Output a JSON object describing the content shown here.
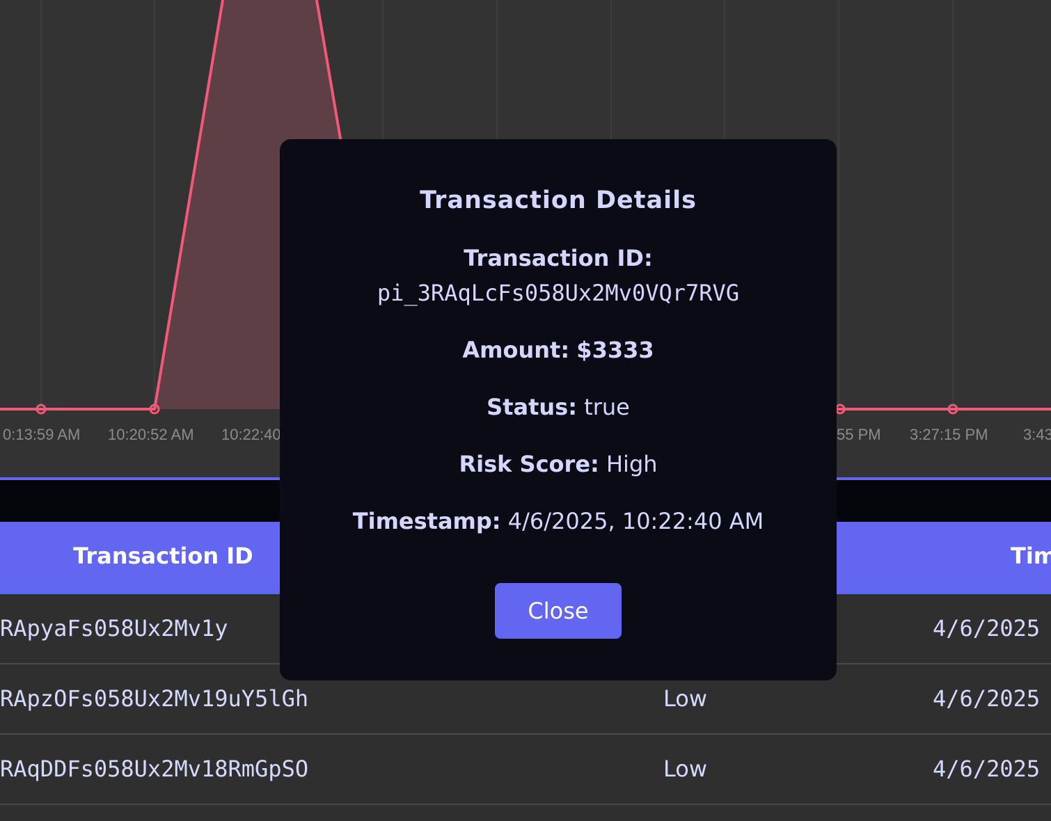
{
  "chart": {
    "x_ticks": [
      "0:13:59 AM",
      "10:20:52 AM",
      "10:22:40",
      "55 PM",
      "3:27:15 PM",
      "3:43"
    ],
    "line_color": "#f05a78",
    "fill_color": "#5e3f45"
  },
  "table": {
    "headers": {
      "transaction_id": "Transaction ID",
      "timestamp": "Tim"
    },
    "rows": [
      {
        "id": "RApyaFs058Ux2Mv1y",
        "risk": "",
        "time": "4/6/2025"
      },
      {
        "id": "RApzOFs058Ux2Mv19uY5lGh",
        "risk": "Low",
        "time": "4/6/2025"
      },
      {
        "id": "RAqDDFs058Ux2Mv18RmGpSO",
        "risk": "Low",
        "time": "4/6/2025"
      }
    ]
  },
  "modal": {
    "title": "Transaction Details",
    "transaction_id_label": "Transaction ID:",
    "transaction_id_value": "pi_3RAqLcFs058Ux2Mv0VQr7RVG",
    "amount_label": "Amount:",
    "amount_value": "$3333",
    "status_label": "Status:",
    "status_value": "true",
    "risk_label": "Risk Score:",
    "risk_value": "High",
    "timestamp_label": "Timestamp:",
    "timestamp_value": "4/6/2025, 10:22:40 AM",
    "close_label": "Close"
  },
  "colors": {
    "accent": "#6366f1",
    "modal_bg": "#0a0b14",
    "modal_text": "#d4d6ff"
  }
}
